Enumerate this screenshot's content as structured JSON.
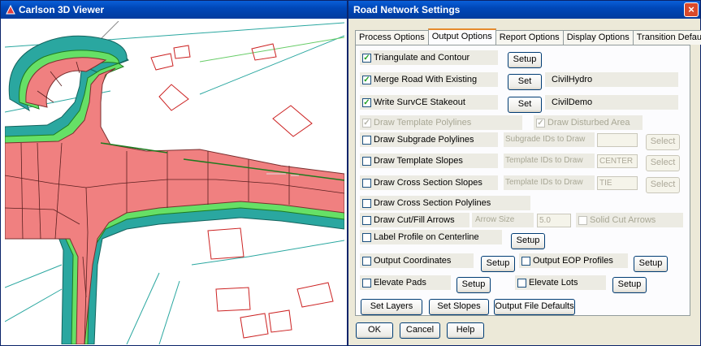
{
  "viewer": {
    "title": "Carlson 3D Viewer"
  },
  "dialog": {
    "title": "Road Network Settings",
    "close": "×",
    "tabs": [
      "Process Options",
      "Output Options",
      "Report Options",
      "Display Options",
      "Transition Defaults"
    ],
    "active_tab": "Output Options",
    "triangulate": {
      "label": "Triangulate and Contour",
      "checked": true,
      "setup": "Setup"
    },
    "merge": {
      "label": "Merge Road With Existing",
      "checked": true,
      "button": "Set",
      "value": "CivilHydro"
    },
    "write": {
      "label": "Write SurvCE Stakeout",
      "checked": true,
      "button": "Set",
      "value": "CivilDemo"
    },
    "draw_template_polylines": {
      "label": "Draw Template Polylines",
      "checked": true,
      "enabled": false
    },
    "draw_disturbed_area": {
      "label": "Draw Disturbed Area",
      "checked": true,
      "enabled": false
    },
    "subgrade": {
      "label": "Draw Subgrade Polylines",
      "checked": false,
      "ids_label": "Subgrade IDs to Draw",
      "ids_value": "",
      "select": "Select"
    },
    "template_slopes": {
      "label": "Draw Template Slopes",
      "checked": false,
      "ids_label": "Template IDs to Draw",
      "ids_value": "CENTER",
      "select": "Select"
    },
    "cross_slopes": {
      "label": "Draw Cross Section Slopes",
      "checked": false,
      "ids_label": "Template IDs to Draw",
      "ids_value": "TIE",
      "select": "Select"
    },
    "cross_polylines": {
      "label": "Draw Cross Section Polylines",
      "checked": false
    },
    "cutfill": {
      "label": "Draw Cut/Fill Arrows",
      "checked": false,
      "size_label": "Arrow Size",
      "size_value": "5.0",
      "solid_label": "Solid Cut Arrows",
      "solid_checked": false
    },
    "label_profile": {
      "label": "Label Profile on Centerline",
      "checked": false,
      "setup": "Setup"
    },
    "out_coords": {
      "label": "Output Coordinates",
      "checked": false,
      "setup": "Setup"
    },
    "out_eop": {
      "label": "Output EOP Profiles",
      "checked": false,
      "setup": "Setup"
    },
    "elev_pads": {
      "label": "Elevate Pads",
      "checked": false,
      "setup": "Setup"
    },
    "elev_lots": {
      "label": "Elevate Lots",
      "checked": false,
      "setup": "Setup"
    },
    "buttons": {
      "set_layers": "Set Layers",
      "set_slopes": "Set Slopes",
      "output_defaults": "Output File Defaults"
    },
    "footer": {
      "ok": "OK",
      "cancel": "Cancel",
      "help": "Help"
    }
  },
  "colors": {
    "road": "#f08080",
    "shoulder": "#66e066",
    "slope": "#2aa7a0",
    "lot": "#cc2222",
    "titlebar": "#0047b8"
  }
}
